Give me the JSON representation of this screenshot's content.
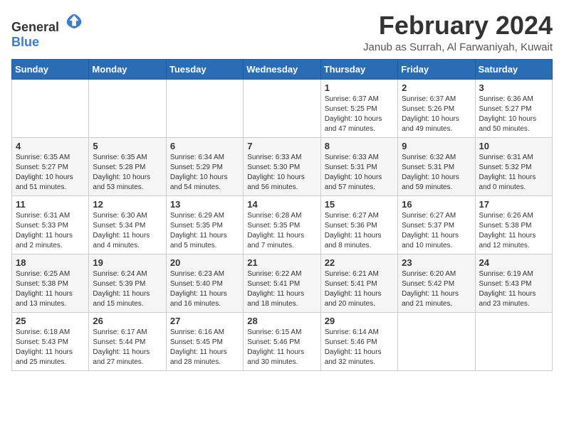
{
  "logo": {
    "general": "General",
    "blue": "Blue"
  },
  "title": "February 2024",
  "subtitle": "Janub as Surrah, Al Farwaniyah, Kuwait",
  "days_of_week": [
    "Sunday",
    "Monday",
    "Tuesday",
    "Wednesday",
    "Thursday",
    "Friday",
    "Saturday"
  ],
  "weeks": [
    [
      {
        "day": null,
        "info": null
      },
      {
        "day": null,
        "info": null
      },
      {
        "day": null,
        "info": null
      },
      {
        "day": null,
        "info": null
      },
      {
        "day": "1",
        "info": "Sunrise: 6:37 AM\nSunset: 5:25 PM\nDaylight: 10 hours\nand 47 minutes."
      },
      {
        "day": "2",
        "info": "Sunrise: 6:37 AM\nSunset: 5:26 PM\nDaylight: 10 hours\nand 49 minutes."
      },
      {
        "day": "3",
        "info": "Sunrise: 6:36 AM\nSunset: 5:27 PM\nDaylight: 10 hours\nand 50 minutes."
      }
    ],
    [
      {
        "day": "4",
        "info": "Sunrise: 6:35 AM\nSunset: 5:27 PM\nDaylight: 10 hours\nand 51 minutes."
      },
      {
        "day": "5",
        "info": "Sunrise: 6:35 AM\nSunset: 5:28 PM\nDaylight: 10 hours\nand 53 minutes."
      },
      {
        "day": "6",
        "info": "Sunrise: 6:34 AM\nSunset: 5:29 PM\nDaylight: 10 hours\nand 54 minutes."
      },
      {
        "day": "7",
        "info": "Sunrise: 6:33 AM\nSunset: 5:30 PM\nDaylight: 10 hours\nand 56 minutes."
      },
      {
        "day": "8",
        "info": "Sunrise: 6:33 AM\nSunset: 5:31 PM\nDaylight: 10 hours\nand 57 minutes."
      },
      {
        "day": "9",
        "info": "Sunrise: 6:32 AM\nSunset: 5:31 PM\nDaylight: 10 hours\nand 59 minutes."
      },
      {
        "day": "10",
        "info": "Sunrise: 6:31 AM\nSunset: 5:32 PM\nDaylight: 11 hours\nand 0 minutes."
      }
    ],
    [
      {
        "day": "11",
        "info": "Sunrise: 6:31 AM\nSunset: 5:33 PM\nDaylight: 11 hours\nand 2 minutes."
      },
      {
        "day": "12",
        "info": "Sunrise: 6:30 AM\nSunset: 5:34 PM\nDaylight: 11 hours\nand 4 minutes."
      },
      {
        "day": "13",
        "info": "Sunrise: 6:29 AM\nSunset: 5:35 PM\nDaylight: 11 hours\nand 5 minutes."
      },
      {
        "day": "14",
        "info": "Sunrise: 6:28 AM\nSunset: 5:35 PM\nDaylight: 11 hours\nand 7 minutes."
      },
      {
        "day": "15",
        "info": "Sunrise: 6:27 AM\nSunset: 5:36 PM\nDaylight: 11 hours\nand 8 minutes."
      },
      {
        "day": "16",
        "info": "Sunrise: 6:27 AM\nSunset: 5:37 PM\nDaylight: 11 hours\nand 10 minutes."
      },
      {
        "day": "17",
        "info": "Sunrise: 6:26 AM\nSunset: 5:38 PM\nDaylight: 11 hours\nand 12 minutes."
      }
    ],
    [
      {
        "day": "18",
        "info": "Sunrise: 6:25 AM\nSunset: 5:38 PM\nDaylight: 11 hours\nand 13 minutes."
      },
      {
        "day": "19",
        "info": "Sunrise: 6:24 AM\nSunset: 5:39 PM\nDaylight: 11 hours\nand 15 minutes."
      },
      {
        "day": "20",
        "info": "Sunrise: 6:23 AM\nSunset: 5:40 PM\nDaylight: 11 hours\nand 16 minutes."
      },
      {
        "day": "21",
        "info": "Sunrise: 6:22 AM\nSunset: 5:41 PM\nDaylight: 11 hours\nand 18 minutes."
      },
      {
        "day": "22",
        "info": "Sunrise: 6:21 AM\nSunset: 5:41 PM\nDaylight: 11 hours\nand 20 minutes."
      },
      {
        "day": "23",
        "info": "Sunrise: 6:20 AM\nSunset: 5:42 PM\nDaylight: 11 hours\nand 21 minutes."
      },
      {
        "day": "24",
        "info": "Sunrise: 6:19 AM\nSunset: 5:43 PM\nDaylight: 11 hours\nand 23 minutes."
      }
    ],
    [
      {
        "day": "25",
        "info": "Sunrise: 6:18 AM\nSunset: 5:43 PM\nDaylight: 11 hours\nand 25 minutes."
      },
      {
        "day": "26",
        "info": "Sunrise: 6:17 AM\nSunset: 5:44 PM\nDaylight: 11 hours\nand 27 minutes."
      },
      {
        "day": "27",
        "info": "Sunrise: 6:16 AM\nSunset: 5:45 PM\nDaylight: 11 hours\nand 28 minutes."
      },
      {
        "day": "28",
        "info": "Sunrise: 6:15 AM\nSunset: 5:46 PM\nDaylight: 11 hours\nand 30 minutes."
      },
      {
        "day": "29",
        "info": "Sunrise: 6:14 AM\nSunset: 5:46 PM\nDaylight: 11 hours\nand 32 minutes."
      },
      {
        "day": null,
        "info": null
      },
      {
        "day": null,
        "info": null
      }
    ]
  ]
}
